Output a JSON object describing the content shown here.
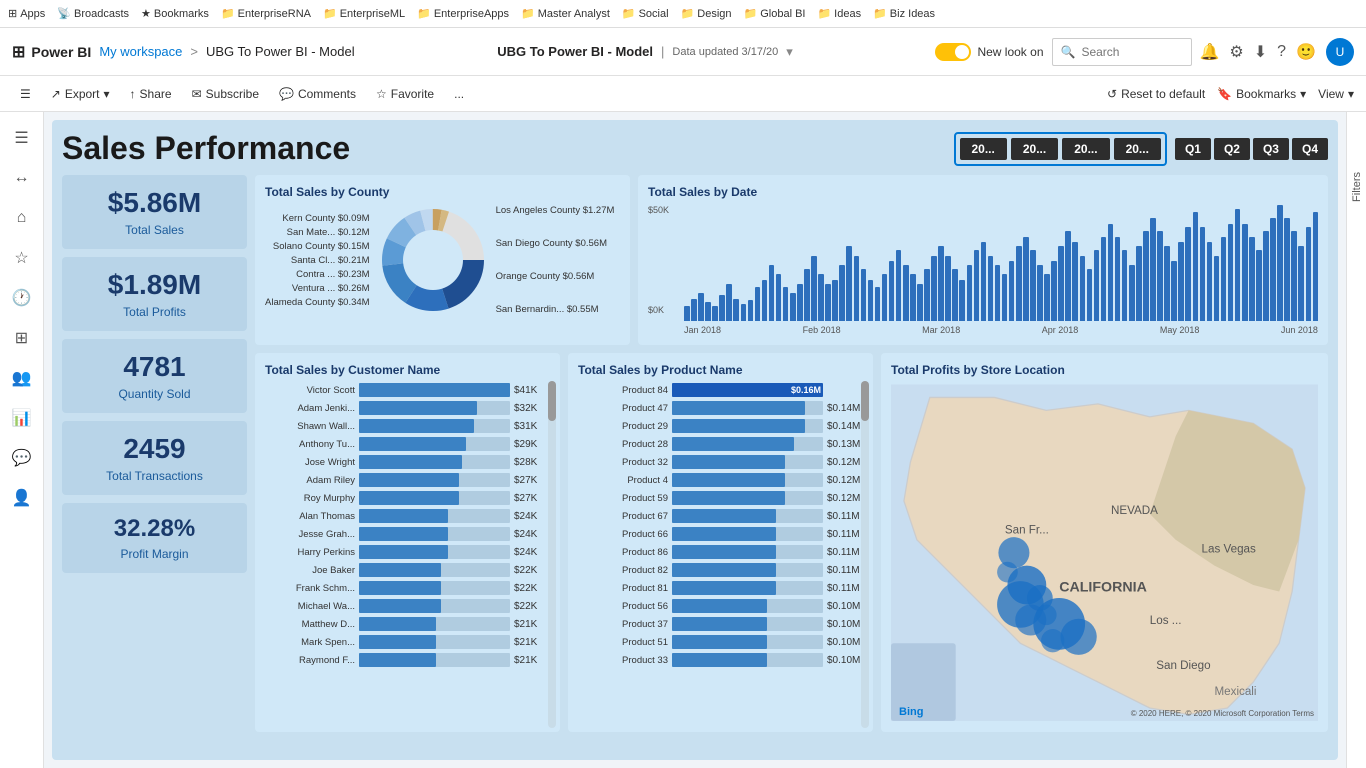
{
  "bookmarks": {
    "items": [
      {
        "label": "Apps",
        "icon": "⊞"
      },
      {
        "label": "Broadcasts",
        "icon": "📡"
      },
      {
        "label": "Bookmarks",
        "icon": "★"
      },
      {
        "label": "EnterpriseRNA",
        "icon": "📁"
      },
      {
        "label": "EnterpriseML",
        "icon": "📁"
      },
      {
        "label": "EnterpriseApps",
        "icon": "📁"
      },
      {
        "label": "Master Analyst",
        "icon": "📁"
      },
      {
        "label": "Social",
        "icon": "📁"
      },
      {
        "label": "Design",
        "icon": "📁"
      },
      {
        "label": "Global BI",
        "icon": "📁"
      },
      {
        "label": "Ideas",
        "icon": "📁"
      },
      {
        "label": "Biz Ideas",
        "icon": "📁"
      }
    ]
  },
  "header": {
    "app_name": "Power BI",
    "workspace": "My workspace",
    "separator": ">",
    "report_name": "UBG To Power BI - Model",
    "center_title": "UBG To Power BI - Model",
    "data_updated": "Data updated 3/17/20",
    "new_look_label": "New look on",
    "search_placeholder": "Search"
  },
  "toolbar": {
    "export_label": "Export",
    "share_label": "Share",
    "subscribe_label": "Subscribe",
    "comments_label": "Comments",
    "favorite_label": "Favorite",
    "more_label": "...",
    "reset_label": "Reset to default",
    "bookmarks_label": "Bookmarks",
    "view_label": "View"
  },
  "sidebar": {
    "items": [
      "☰",
      "↔",
      "⌂",
      "☆",
      "🕐",
      "📊",
      "🔔",
      "👤",
      "💬",
      "👤"
    ]
  },
  "dashboard": {
    "title": "Sales Performance",
    "year_filters": [
      "20...",
      "20...",
      "20...",
      "20..."
    ],
    "quarter_filters": [
      "Q1",
      "Q2",
      "Q3",
      "Q4"
    ],
    "metrics": [
      {
        "value": "$5.86M",
        "label": "Total Sales"
      },
      {
        "value": "$1.89M",
        "label": "Total Profits"
      },
      {
        "value": "4781",
        "label": "Quantity Sold"
      },
      {
        "value": "2459",
        "label": "Total Transactions"
      },
      {
        "value": "32.28%",
        "label": "Profit Margin"
      }
    ],
    "county_chart": {
      "title": "Total Sales by County",
      "labels_left": [
        "Kern County $0.09M",
        "San Mate... $0.12M",
        "Solano County $0.15M",
        "Santa Cl... $0.21M",
        "Contra ... $0.23M",
        "Ventura ... $0.26M",
        "Alameda County $0.34M"
      ],
      "labels_right": [
        "Los Angeles County $1.27M",
        "",
        "San Diego County $0.56M",
        "",
        "Orange County $0.56M",
        "",
        "San Bernardin... $0.55M"
      ]
    },
    "date_chart": {
      "title": "Total Sales by Date",
      "y_labels": [
        "$50K",
        "",
        "$0K"
      ],
      "x_labels": [
        "Jan 2018",
        "Feb 2018",
        "Mar 2018",
        "Apr 2018",
        "May 2018",
        "Jun 2018"
      ],
      "bars": [
        8,
        12,
        15,
        10,
        8,
        14,
        20,
        12,
        9,
        11,
        18,
        22,
        30,
        25,
        18,
        15,
        20,
        28,
        35,
        25,
        20,
        22,
        30,
        40,
        35,
        28,
        22,
        18,
        25,
        32,
        38,
        30,
        25,
        20,
        28,
        35,
        40,
        35,
        28,
        22,
        30,
        38,
        42,
        35,
        30,
        25,
        32,
        40,
        45,
        38,
        30,
        25,
        32,
        40,
        48,
        42,
        35,
        28,
        38,
        45,
        52,
        45,
        38,
        30,
        40,
        48,
        55,
        48,
        40,
        32,
        42,
        50,
        58,
        50,
        42,
        35,
        45,
        52,
        60,
        52,
        45,
        38,
        48,
        55,
        62,
        55,
        48,
        40,
        50,
        58
      ]
    },
    "customer_chart": {
      "title": "Total Sales by Customer Name",
      "rows": [
        {
          "name": "Victor Scott",
          "value": "$41K",
          "pct": 100
        },
        {
          "name": "Adam Jenki...",
          "value": "$32K",
          "pct": 78
        },
        {
          "name": "Shawn Wall...",
          "value": "$31K",
          "pct": 76
        },
        {
          "name": "Anthony Tu...",
          "value": "$29K",
          "pct": 71
        },
        {
          "name": "Jose Wright",
          "value": "$28K",
          "pct": 68
        },
        {
          "name": "Adam Riley",
          "value": "$27K",
          "pct": 66
        },
        {
          "name": "Roy Murphy",
          "value": "$27K",
          "pct": 66
        },
        {
          "name": "Alan Thomas",
          "value": "$24K",
          "pct": 59
        },
        {
          "name": "Jesse Grah...",
          "value": "$24K",
          "pct": 59
        },
        {
          "name": "Harry Perkins",
          "value": "$24K",
          "pct": 59
        },
        {
          "name": "Joe Baker",
          "value": "$22K",
          "pct": 54
        },
        {
          "name": "Frank Schm...",
          "value": "$22K",
          "pct": 54
        },
        {
          "name": "Michael Wa...",
          "value": "$22K",
          "pct": 54
        },
        {
          "name": "Matthew D...",
          "value": "$21K",
          "pct": 51
        },
        {
          "name": "Mark Spen...",
          "value": "$21K",
          "pct": 51
        },
        {
          "name": "Raymond F...",
          "value": "$21K",
          "pct": 51
        }
      ]
    },
    "product_chart": {
      "title": "Total Sales by Product Name",
      "rows": [
        {
          "name": "Product 84",
          "value": "$0.16M",
          "pct": 100
        },
        {
          "name": "Product 47",
          "value": "$0.14M",
          "pct": 88
        },
        {
          "name": "Product 29",
          "value": "$0.14M",
          "pct": 88
        },
        {
          "name": "Product 28",
          "value": "$0.13M",
          "pct": 81
        },
        {
          "name": "Product 32",
          "value": "$0.12M",
          "pct": 75
        },
        {
          "name": "Product 4",
          "value": "$0.12M",
          "pct": 75
        },
        {
          "name": "Product 59",
          "value": "$0.12M",
          "pct": 75
        },
        {
          "name": "Product 67",
          "value": "$0.11M",
          "pct": 69
        },
        {
          "name": "Product 66",
          "value": "$0.11M",
          "pct": 69
        },
        {
          "name": "Product 86",
          "value": "$0.11M",
          "pct": 69
        },
        {
          "name": "Product 82",
          "value": "$0.11M",
          "pct": 69
        },
        {
          "name": "Product 81",
          "value": "$0.11M",
          "pct": 69
        },
        {
          "name": "Product 56",
          "value": "$0.10M",
          "pct": 63
        },
        {
          "name": "Product 37",
          "value": "$0.10M",
          "pct": 63
        },
        {
          "name": "Product 51",
          "value": "$0.10M",
          "pct": 63
        },
        {
          "name": "Product 33",
          "value": "$0.10M",
          "pct": 63
        }
      ]
    },
    "map_chart": {
      "title": "Total Profits by Store Location",
      "bing_label": "Bing",
      "copyright": "© 2020 HERE, © 2020 Microsoft Corporation  Terms"
    }
  }
}
